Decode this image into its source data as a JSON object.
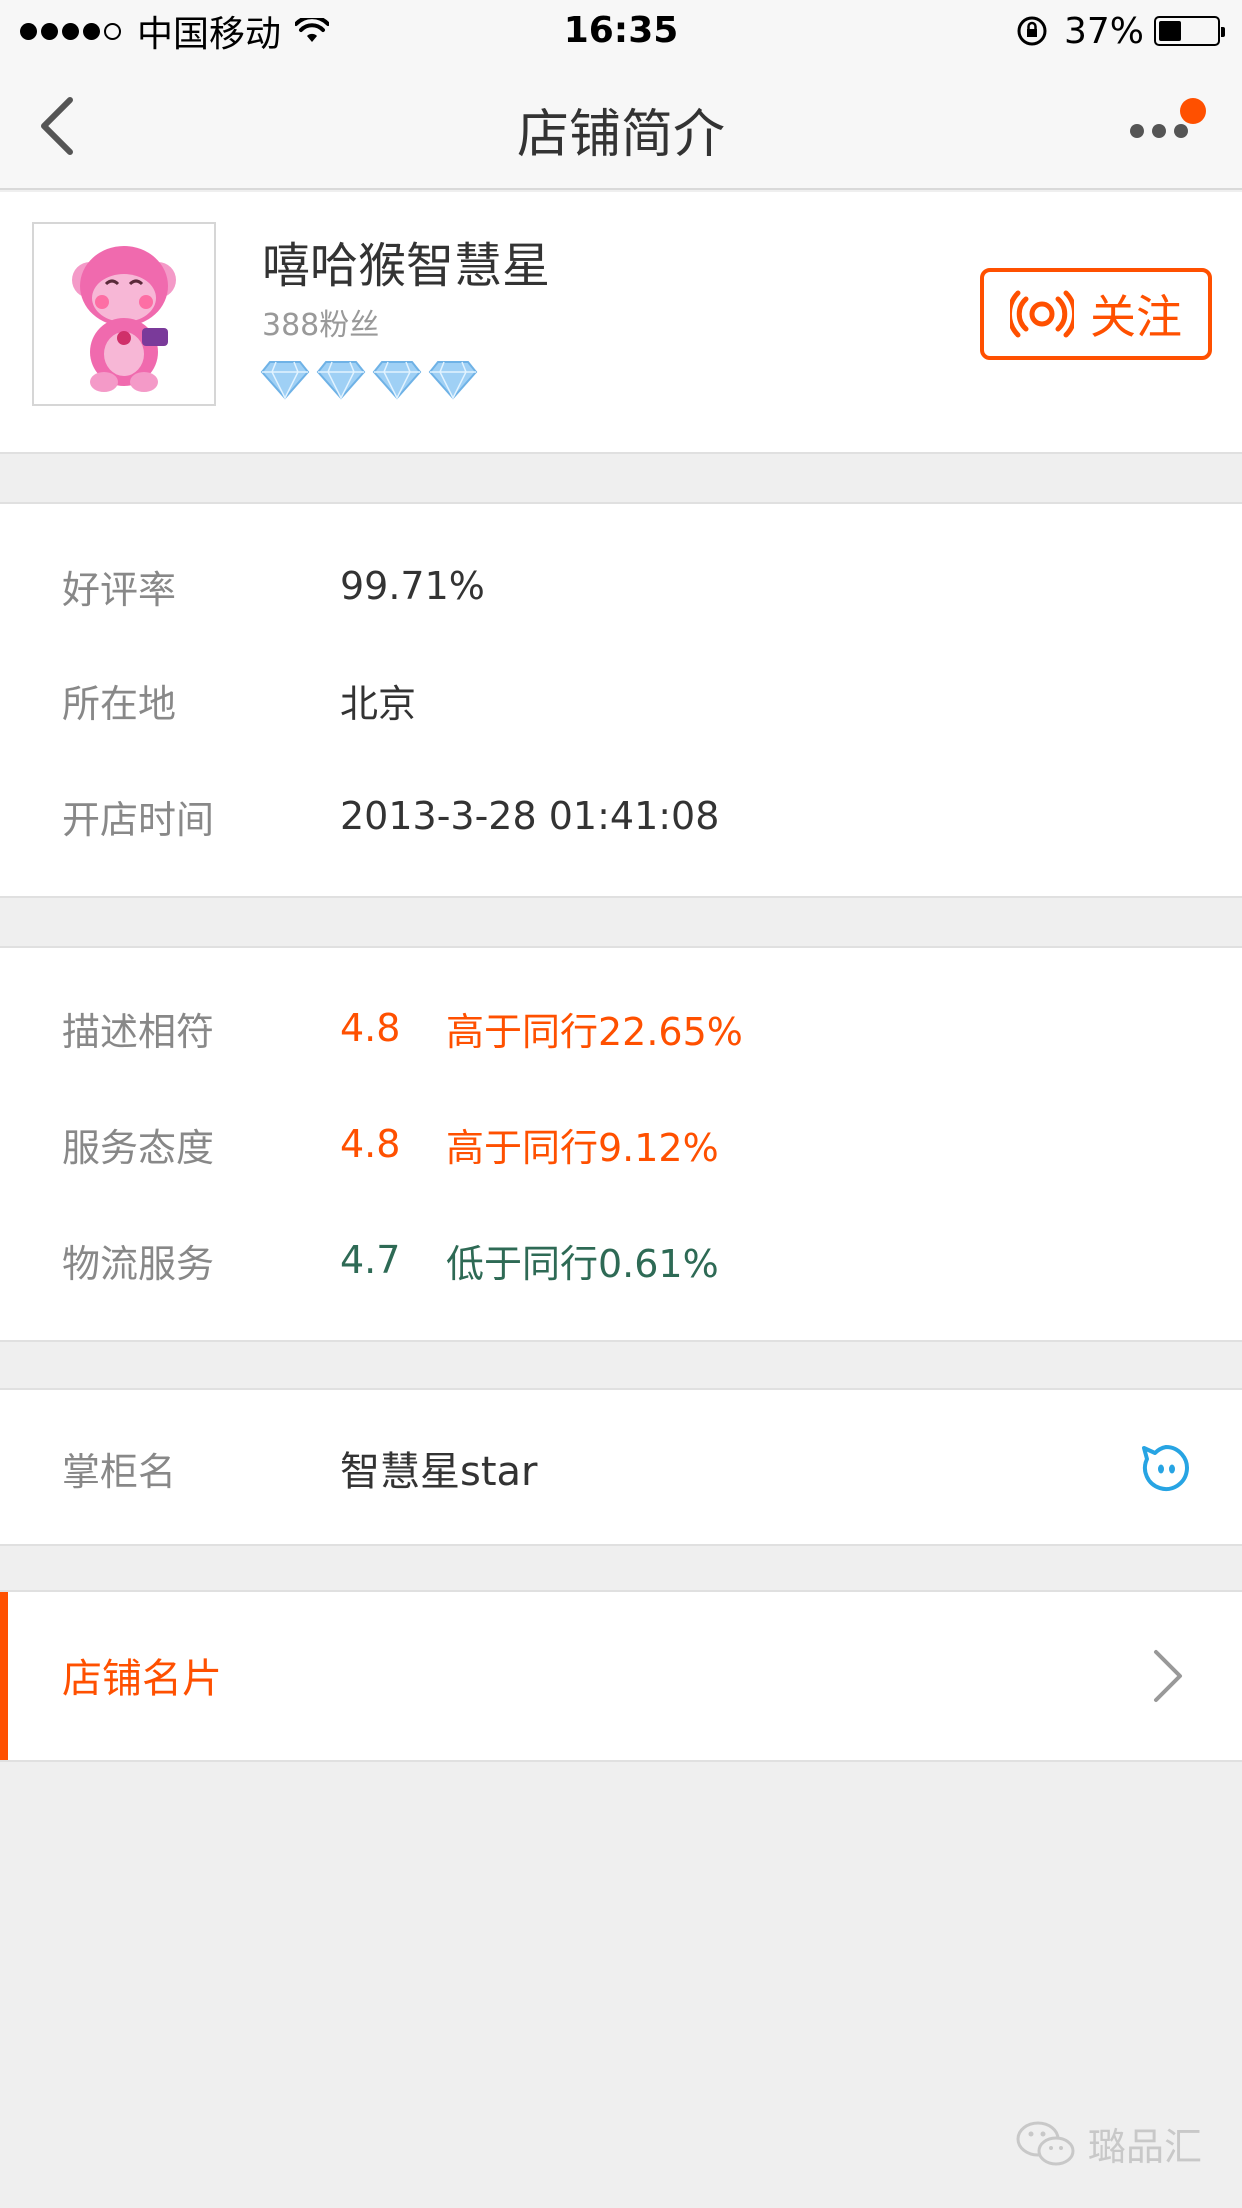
{
  "status_bar": {
    "carrier": "中国移动",
    "time": "16:35",
    "battery": "37%",
    "battery_level": 0.37,
    "signal_bars": 4
  },
  "nav": {
    "title": "店铺简介",
    "back_icon": "chevron-left-icon",
    "more_icon": "more-dots-icon",
    "badge_color": "#ff5000"
  },
  "shop": {
    "name": "嘻哈猴智慧星",
    "fans": "388粉丝",
    "diamond_count": 4,
    "follow_label": "关注",
    "follow_icon": "broadcast-icon",
    "accent": "#ff5000"
  },
  "info": [
    {
      "label": "好评率",
      "value": "99.71%"
    },
    {
      "label": "所在地",
      "value": "北京"
    },
    {
      "label": "开店时间",
      "value": "2013-3-28 01:41:08"
    }
  ],
  "ratings": [
    {
      "label": "描述相符",
      "score": "4.8",
      "compare": "高于同行22.65%",
      "color": "#ff5000"
    },
    {
      "label": "服务态度",
      "score": "4.8",
      "compare": "高于同行9.12%",
      "color": "#ff5000"
    },
    {
      "label": "物流服务",
      "score": "4.7",
      "compare": "低于同行0.61%",
      "color": "#2e6a55"
    }
  ],
  "owner": {
    "label": "掌柜名",
    "value": "智慧星star",
    "chat_icon": "wangwang-chat-icon"
  },
  "card": {
    "label": "店铺名片",
    "chevron_icon": "chevron-right-icon"
  },
  "watermark": {
    "text": "璐品汇",
    "icon": "wechat-icon"
  }
}
